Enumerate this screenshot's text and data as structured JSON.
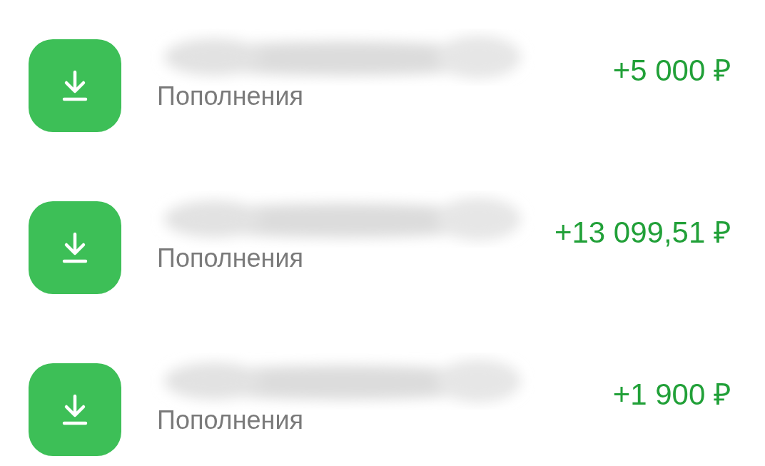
{
  "operations": [
    {
      "category": "Пополнения",
      "amount": "+5 000 ₽"
    },
    {
      "category": "Пополнения",
      "amount": "+13 099,51 ₽"
    },
    {
      "category": "Пополнения",
      "amount": "+1 900 ₽"
    }
  ]
}
